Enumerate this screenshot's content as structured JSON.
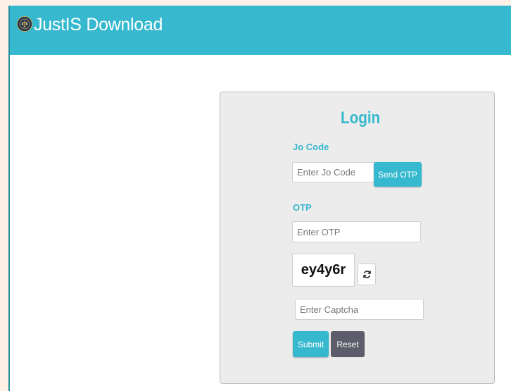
{
  "header": {
    "title": "JustIS Download",
    "logo_icon": "emblem-icon"
  },
  "login": {
    "title": "Login",
    "jo_code": {
      "label": "Jo Code",
      "placeholder": "Enter Jo Code",
      "value": ""
    },
    "send_otp_label": "Send OTP",
    "otp": {
      "label": "OTP",
      "placeholder": "Enter OTP",
      "value": ""
    },
    "captcha": {
      "text": "ey4y6r",
      "refresh_icon": "refresh-icon",
      "placeholder": "Enter Captcha",
      "value": ""
    },
    "submit_label": "Submit",
    "reset_label": "Reset"
  },
  "colors": {
    "accent": "#36b8ce",
    "panel_bg": "#ececec",
    "reset_button": "#5c5c6a"
  }
}
